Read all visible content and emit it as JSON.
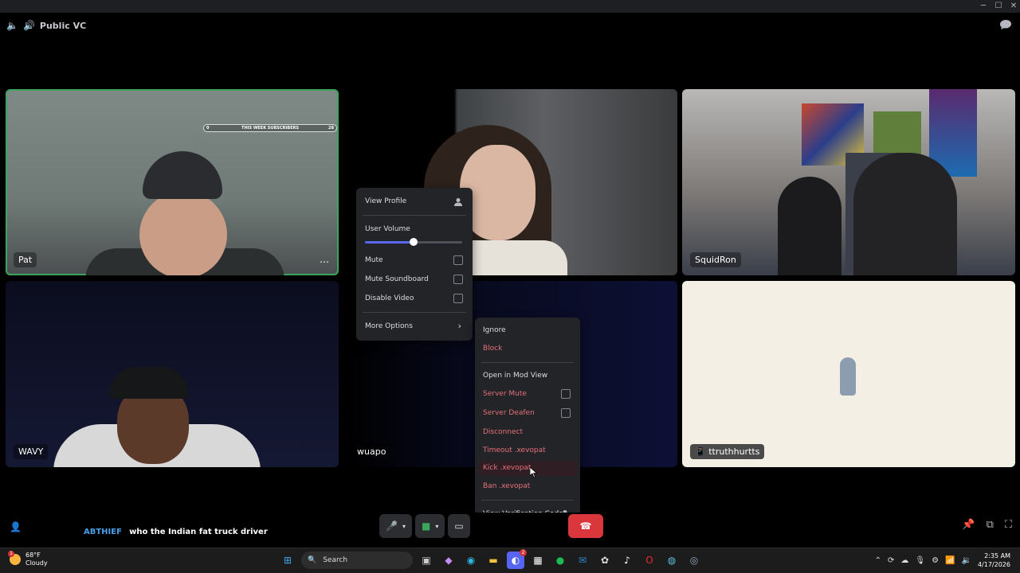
{
  "window": {
    "minimize": "─",
    "maximize": "☐",
    "close": "✕"
  },
  "channel": {
    "name": "Public VC"
  },
  "tiles": {
    "pat": {
      "name": "Pat",
      "overlay_text": "THIS WEEK SUBSCRIBERS",
      "overlay_left": "0",
      "overlay_right": "28",
      "more": "⋯"
    },
    "squid": {
      "name": "SquidRon"
    },
    "wavy": {
      "name": "WAVY"
    },
    "wuapo": {
      "name": "wuapo"
    },
    "tt": {
      "name": "ttruthhurtts"
    }
  },
  "context_menu": {
    "view_profile": "View Profile",
    "user_volume": "User Volume",
    "volume_level": 0.5,
    "mute": "Mute",
    "mute_soundboard": "Mute Soundboard",
    "disable_video": "Disable Video",
    "more_options": "More Options"
  },
  "submenu": {
    "ignore": "Ignore",
    "block": "Block",
    "open_mod_view": "Open in Mod View",
    "server_mute": "Server Mute",
    "server_deafen": "Server Deafen",
    "disconnect": "Disconnect",
    "timeout": "Timeout .xevopat",
    "kick": "Kick .xevopat",
    "ban": "Ban .xevopat",
    "view_verification": "View Verification Code"
  },
  "chat": {
    "user": "ABTHIEF",
    "message": "who the Indian fat truck driver"
  },
  "taskbar": {
    "weather_temp": "68°F",
    "weather_desc": "Cloudy",
    "weather_badge": "1",
    "search": "Search",
    "discord_badge": "2",
    "time": "2:35 AM",
    "date": "4/17/2026"
  },
  "colors": {
    "accent": "#5865f2",
    "danger": "#e5717a",
    "speaking": "#3ba55d",
    "end_call": "#da373c"
  }
}
